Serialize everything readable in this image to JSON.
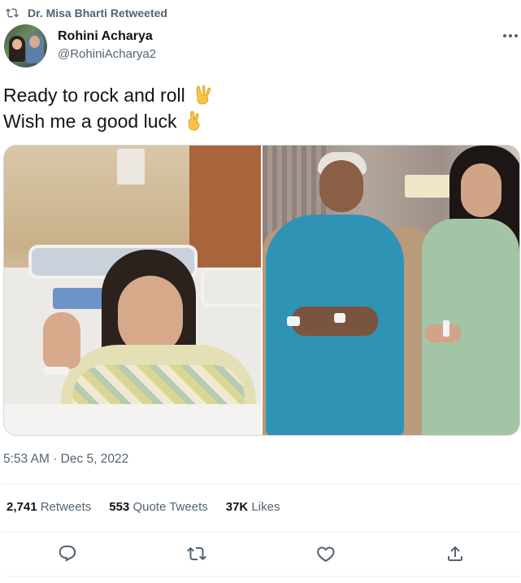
{
  "retweet_context": {
    "text": "Dr. Misa Bharti Retweeted",
    "icon": "retweet-icon"
  },
  "author": {
    "name": "Rohini Acharya",
    "handle": "@RohiniAcharya2"
  },
  "tweet": {
    "line1": "Ready to rock and roll",
    "line1_emoji": "victory-hand-emoji",
    "line2": "Wish me a good luck",
    "line2_emoji": "crossed-fingers-emoji"
  },
  "media": {
    "photos": [
      {
        "icon": "photo-hospital-bed"
      },
      {
        "icon": "photo-hospital-room"
      }
    ]
  },
  "timestamp": {
    "time": "5:53 AM",
    "separator": "·",
    "date": "Dec 5, 2022"
  },
  "stats": {
    "retweets": {
      "count": "2,741",
      "label": "Retweets"
    },
    "quotes": {
      "count": "553",
      "label": "Quote Tweets"
    },
    "likes": {
      "count": "37K",
      "label": "Likes"
    }
  },
  "actions": [
    "reply-icon",
    "retweet-icon",
    "like-icon",
    "share-icon"
  ],
  "colors": {
    "text": "#0f1419",
    "secondary": "#536471",
    "border": "#cfd9de",
    "divider": "#eff3f4"
  }
}
